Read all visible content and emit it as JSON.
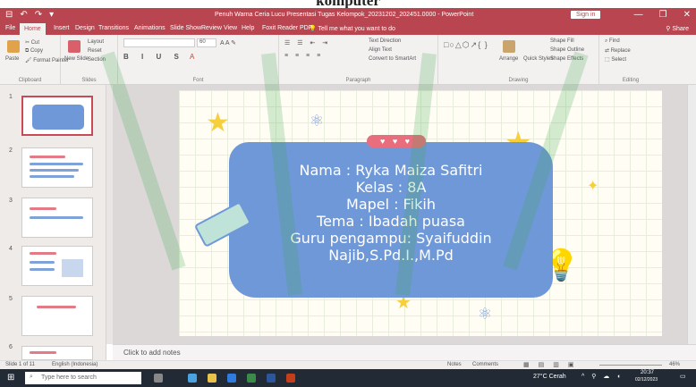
{
  "heading": "komputer",
  "window": {
    "title": "Penuh Warna Ceria Lucu Presentasi Tugas Kelompok_20231202_202451.0000 - PowerPoint",
    "signin": "Sign in",
    "qat": [
      "⊟",
      "↶",
      "↷",
      "▾"
    ],
    "controls": [
      "—",
      "❐",
      "✕"
    ]
  },
  "tabs": [
    "File",
    "Home",
    "Insert",
    "Design",
    "Transitions",
    "Animations",
    "Slide Show",
    "Review",
    "View",
    "Help",
    "Foxit Reader PDF",
    "Tell me what you want to do"
  ],
  "share": "Share",
  "ribbon": {
    "clipboard": {
      "paste": "Paste",
      "cut": "Cut",
      "copy": "Copy",
      "painter": "Format Painter",
      "label": "Clipboard"
    },
    "slides": {
      "new_slide": "New Slide",
      "layout": "Layout",
      "reset": "Reset",
      "section": "Section",
      "label": "Slides"
    },
    "font": {
      "size": "60",
      "label": "Font"
    },
    "paragraph": {
      "text_direction": "Text Direction",
      "align_text": "Align Text",
      "smartart": "Convert to SmartArt",
      "label": "Paragraph"
    },
    "drawing": {
      "arrange": "Arrange",
      "quick_styles": "Quick Styles",
      "fill": "Shape Fill",
      "outline": "Shape Outline",
      "effects": "Shape Effects",
      "label": "Drawing"
    },
    "editing": {
      "find": "Find",
      "replace": "Replace",
      "select": "Select",
      "label": "Editing"
    }
  },
  "thumbnails": [
    {
      "num": "1"
    },
    {
      "num": "2"
    },
    {
      "num": "3"
    },
    {
      "num": "4"
    },
    {
      "num": "5"
    },
    {
      "num": "6"
    }
  ],
  "slide": {
    "pill": "♥ ♥ ♥",
    "lines": [
      "Nama : Ryka Maiza Safitri",
      "Kelas : 8A",
      "Mapel : Fikih",
      "Tema : Ibadah puasa",
      "Guru pengampu: Syaifuddin",
      "Najib,S.Pd.I.,M.Pd"
    ]
  },
  "notes_placeholder": "Click to add notes",
  "status": {
    "slide": "Slide 1 of 11",
    "language": "English (Indonesia)",
    "notes": "Notes",
    "comments": "Comments",
    "zoom": "46%"
  },
  "taskbar": {
    "search": "Type here to search",
    "weather": "27°C  Cerah",
    "time": "20:37",
    "date": "02/12/2023"
  },
  "colors": {
    "accent": "#b8454f",
    "card": "#6f98d8",
    "star": "#f7cf3a",
    "pill": "#e86e7e"
  }
}
